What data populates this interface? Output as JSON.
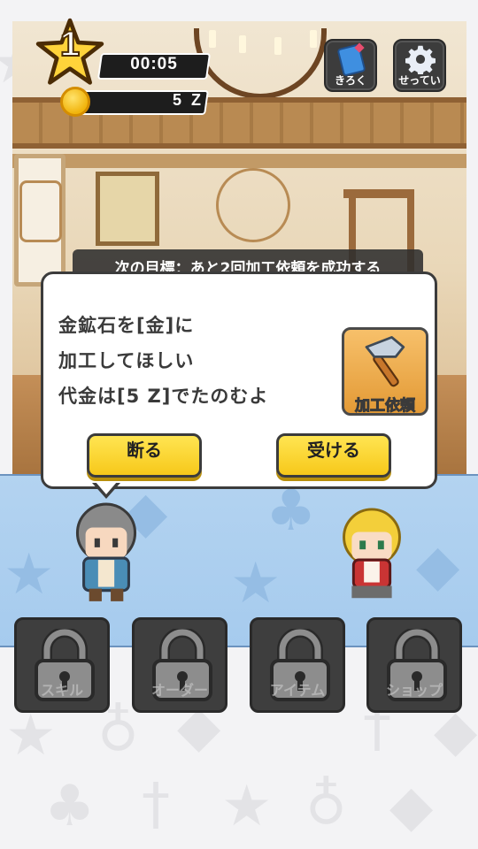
{
  "hud": {
    "level": "1",
    "timer": "00:05",
    "money": "5 Z",
    "record_label": "きろく",
    "settings_label": "せってい"
  },
  "goal": {
    "text": "次の目標：あと2回加工依頼を成功する"
  },
  "dialog": {
    "lines": [
      "金鉱石を[金]に",
      "加工してほしい",
      "代金は[5 Z]でたのむよ"
    ],
    "craft_label": "加工依頼",
    "decline_label": "断る",
    "accept_label": "受ける"
  },
  "tabs": [
    {
      "label": "スキル",
      "locked": true
    },
    {
      "label": "オーダー",
      "locked": true
    },
    {
      "label": "アイテム",
      "locked": true
    },
    {
      "label": "ショップ",
      "locked": true
    }
  ],
  "colors": {
    "accent_yellow": "#f7c81a",
    "floor_blue": "#a6cbee",
    "dark_panel": "#3e3e3e"
  }
}
